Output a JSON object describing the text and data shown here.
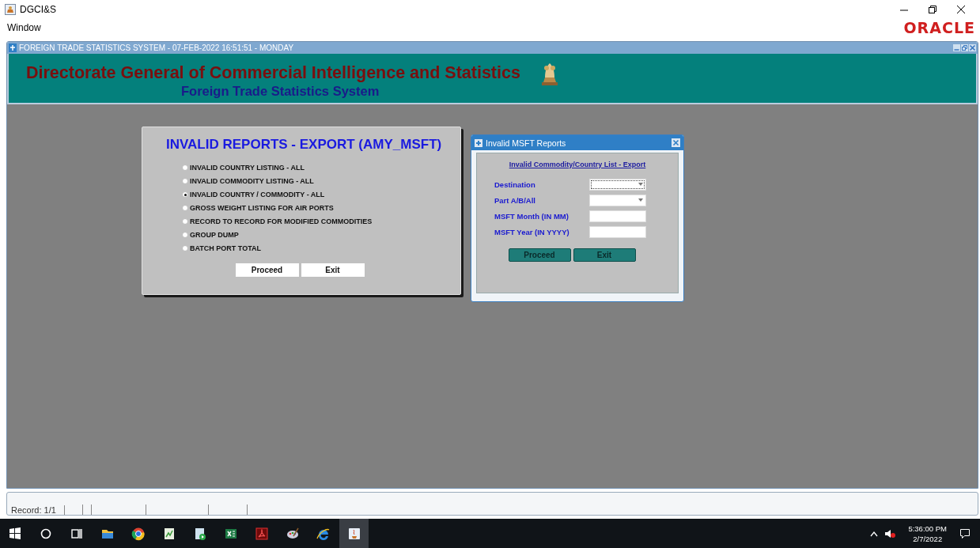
{
  "app_title": "DGCI&S",
  "menu": [
    "Window"
  ],
  "brand": "ORACLE",
  "mdi": {
    "title": "FOREIGN TRADE STATISTICS SYSTEM - 07-FEB-2022 16:51:51 - MONDAY",
    "heading": "Directorate General of Commercial Intelligence and Statistics",
    "subheading": "Foreign Trade Statistics System"
  },
  "report_panel": {
    "title": "INVALID REPORTS - EXPORT (AMY_MSFT)",
    "options": [
      {
        "label": "INVALID COUNTRY LISTING - ALL",
        "selected": false
      },
      {
        "label": "INVALID COMMODITY LISTING - ALL",
        "selected": false
      },
      {
        "label": "INVALID COUNTRY / COMMODITY - ALL",
        "selected": true
      },
      {
        "label": "GROSS WEIGHT LISTING FOR AIR PORTS",
        "selected": false
      },
      {
        "label": "RECORD TO RECORD FOR MODIFIED COMMODITIES",
        "selected": false
      },
      {
        "label": "GROUP DUMP",
        "selected": false
      },
      {
        "label": "BATCH PORT TOTAL",
        "selected": false
      }
    ],
    "buttons": [
      "Proceed",
      "Exit"
    ]
  },
  "dialog": {
    "title": "Invalid MSFT Reports",
    "link": "Invalid Commodity/Country List - Export",
    "fields": [
      {
        "label": "Destination",
        "kind": "dropdown",
        "focused": true
      },
      {
        "label": "Part A/B/All",
        "kind": "dropdown",
        "focused": false
      },
      {
        "label": "MSFT Month (IN MM)",
        "kind": "text",
        "focused": false
      },
      {
        "label": "MSFT Year (IN YYYY)",
        "kind": "text",
        "focused": false
      }
    ],
    "buttons": [
      "Proceed",
      "Exit"
    ]
  },
  "status_bar": {
    "record": "Record: 1/1"
  },
  "taskbar": {
    "time": "5:36:00 PM",
    "date": "2/7/2022"
  }
}
